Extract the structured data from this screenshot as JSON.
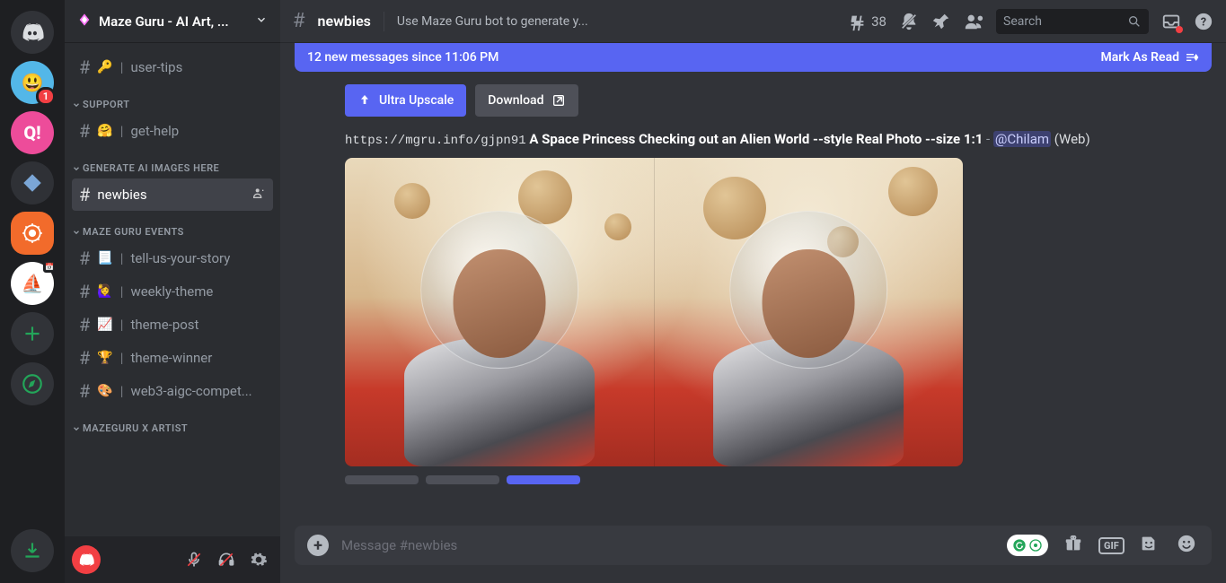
{
  "server": {
    "title": "Maze Guru - AI Art, ...",
    "notification_count": "1"
  },
  "categories": [
    {
      "name": "",
      "channels": [
        {
          "emoji": "🔑",
          "label": "user-tips",
          "selected": false
        }
      ]
    },
    {
      "name": "SUPPORT",
      "channels": [
        {
          "emoji": "🤗",
          "label": "get-help",
          "selected": false
        }
      ]
    },
    {
      "name": "GENERATE AI IMAGES HERE",
      "channels": [
        {
          "emoji": "",
          "label": "newbies",
          "selected": true,
          "add_user": true
        }
      ]
    },
    {
      "name": "MAZE GURU EVENTS",
      "channels": [
        {
          "emoji": "📃",
          "label": "tell-us-your-story",
          "selected": false
        },
        {
          "emoji": "🙋‍♀️",
          "label": "weekly-theme",
          "selected": false
        },
        {
          "emoji": "📈",
          "label": "theme-post",
          "selected": false
        },
        {
          "emoji": "🏆",
          "label": "theme-winner",
          "selected": false
        },
        {
          "emoji": "🎨",
          "label": "web3-aigc-compet...",
          "selected": false
        }
      ]
    },
    {
      "name": "MAZEGURU X ARTIST",
      "channels": []
    }
  ],
  "topbar": {
    "channel": "newbies",
    "topic": "Use Maze Guru bot to generate y...",
    "thread_count": "38",
    "search_placeholder": "Search"
  },
  "new_msg_bar": {
    "text": "12 new messages since 11:06 PM",
    "mark": "Mark As Read"
  },
  "buttons": {
    "upscale": "Ultra Upscale",
    "download": "Download"
  },
  "message": {
    "url": "https://mgru.info/gjpn91",
    "prompt": "A Space Princess Checking out an Alien World --style Real Photo --size 1:1",
    "dash": " - ",
    "mention": "@Chilam",
    "suffix": " (Web)"
  },
  "compose": {
    "placeholder": "Message #newbies",
    "gif": "GIF"
  }
}
